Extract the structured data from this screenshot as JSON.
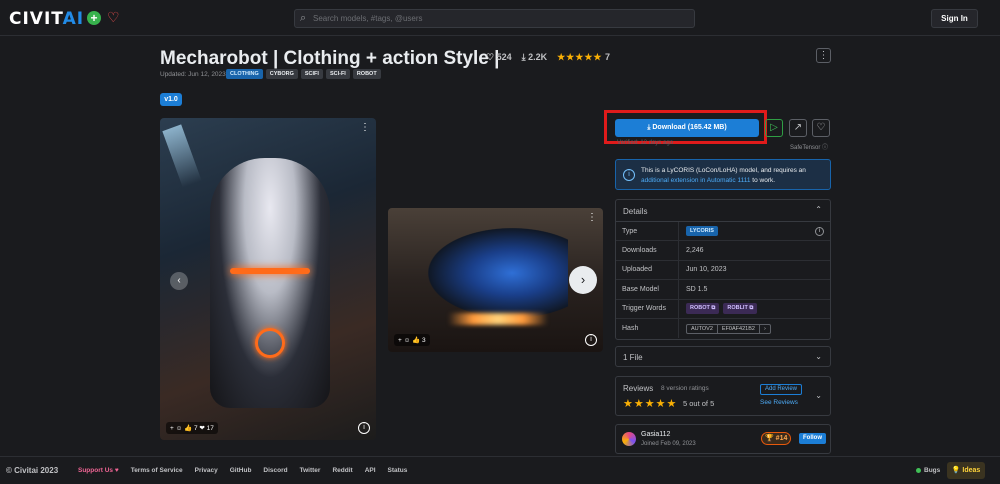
{
  "header": {
    "logo_main": "CIVIT",
    "logo_ai": "AI",
    "search_placeholder": "Search models, #tags, @users",
    "signin_label": "Sign In"
  },
  "model": {
    "title": "Mecharobot | Clothing + action Style |",
    "likes": "524",
    "downloads": "2.2K",
    "stars": "★★★★★",
    "rating_count": "7",
    "updated": "Updated: Jun 12, 2023",
    "tags": [
      "CLOTHING",
      "CYBORG",
      "SCIFI",
      "SCI-FI",
      "ROBOT"
    ],
    "version": "v1.0"
  },
  "gallery": {
    "main_reactions": "+ ☺  👍 7  ❤ 17",
    "side_reactions": "+ ☺  👍 3"
  },
  "actions": {
    "download_label": "Download (165.42 MB)",
    "verified": "Verified: 12 days ago",
    "safetensor": "SafeTensor"
  },
  "alert": {
    "text_pre": "This is a LyCORIS (LoCon/LoHA) model, and requires an ",
    "link": "additional extension in Automatic 1111",
    "text_post": " to work."
  },
  "details": {
    "title": "Details",
    "rows": [
      {
        "key": "Type",
        "value": "LYCORIS"
      },
      {
        "key": "Downloads",
        "value": "2,246"
      },
      {
        "key": "Uploaded",
        "value": "Jun 10, 2023"
      },
      {
        "key": "Base Model",
        "value": "SD 1.5"
      },
      {
        "key": "Trigger Words",
        "value": "ROBOT",
        "value2": "ROBLIT"
      },
      {
        "key": "Hash",
        "value": "AUTOV2",
        "value2": "EF0AF421B2"
      }
    ]
  },
  "files": {
    "label": "1 File"
  },
  "reviews": {
    "label": "Reviews",
    "count": "8 version ratings",
    "stars": "★★★★★",
    "score": "5 out of 5",
    "add": "Add Review",
    "see": "See Reviews"
  },
  "creator": {
    "name": "Gasia112",
    "joined": "Joined Feb 09, 2023",
    "rank": "#14",
    "follow": "Follow"
  },
  "footer": {
    "copyright": "© Civitai 2023",
    "links": [
      "Support Us ♥",
      "Terms of Service",
      "Privacy",
      "GitHub",
      "Discord",
      "Twitter",
      "Reddit",
      "API",
      "Status"
    ],
    "bugs": "Bugs",
    "ideas": "💡 Ideas"
  }
}
